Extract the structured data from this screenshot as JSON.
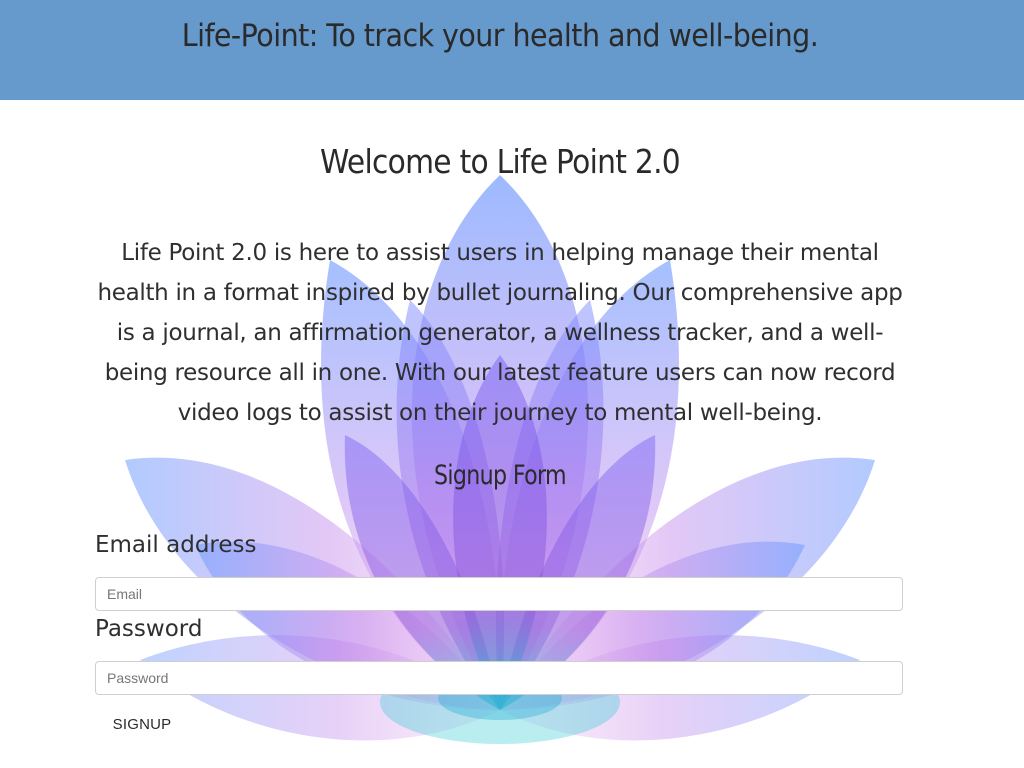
{
  "header": {
    "title": "Life-Point: To track your health and well-being."
  },
  "main": {
    "welcome_heading": "Welcome to Life Point 2.0",
    "intro_text": "Life Point 2.0 is here to assist users in helping manage their mental health in a format inspired by bullet journaling. Our comprehensive app is a journal, an affirmation generator, a wellness tracker, and a well-being resource all in one. With our latest feature users can now record video logs to assist on their journey to mental well-being."
  },
  "signup": {
    "title": "Signup Form",
    "email_label": "Email address",
    "email_placeholder": "Email",
    "email_value": "",
    "password_label": "Password",
    "password_placeholder": "Password",
    "password_value": "",
    "button_label": "SIGNUP"
  },
  "colors": {
    "header_background": "#6699cc",
    "page_background": "#ffffff",
    "text": "#2f2f2f",
    "lotus_petals": [
      "#4f83ff",
      "#a97cf3",
      "#cf9de9",
      "#8a5fe2",
      "#1fbfd0"
    ]
  },
  "icons": {
    "background_art": "lotus-flower-illustration"
  }
}
